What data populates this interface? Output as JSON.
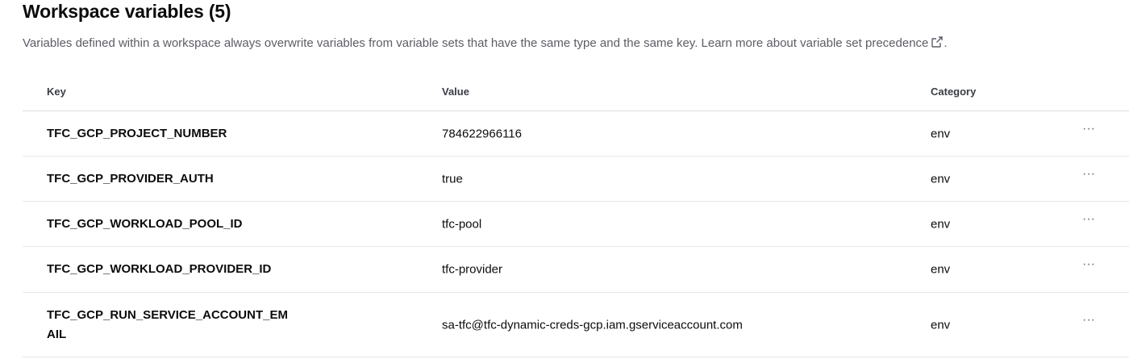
{
  "page": {
    "title": "Workspace variables (5)",
    "description": "Variables defined within a workspace always overwrite variables from variable sets that have the same type and the same key. Learn more about ",
    "link_text": "variable set precedence",
    "after_link": "."
  },
  "table": {
    "headers": {
      "key": "Key",
      "value": "Value",
      "category": "Category"
    },
    "rows": [
      {
        "key": "TFC_GCP_PROJECT_NUMBER",
        "value": "784622966116",
        "category": "env",
        "menu": "···"
      },
      {
        "key": "TFC_GCP_PROVIDER_AUTH",
        "value": "true",
        "category": "env",
        "menu": "···"
      },
      {
        "key": "TFC_GCP_WORKLOAD_POOL_ID",
        "value": "tfc-pool",
        "category": "env",
        "menu": "···"
      },
      {
        "key": "TFC_GCP_WORKLOAD_PROVIDER_ID",
        "value": "tfc-provider",
        "category": "env",
        "menu": "···"
      },
      {
        "key": "TFC_GCP_RUN_SERVICE_ACCOUNT_EMAIL",
        "value": "sa-tfc@tfc-dynamic-creds-gcp.iam.gserviceaccount.com",
        "category": "env",
        "menu": "···"
      }
    ]
  },
  "icons": {
    "link": "external-link-icon",
    "row_menu": "ellipsis-icon"
  }
}
